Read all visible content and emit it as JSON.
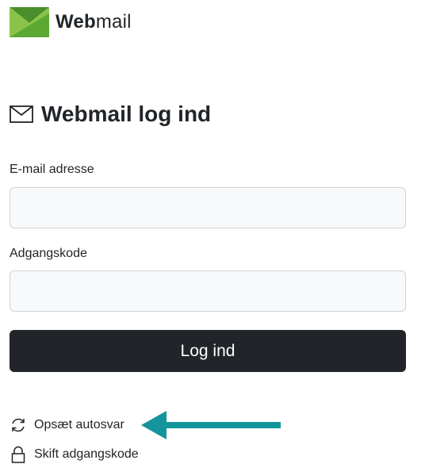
{
  "brand": {
    "name_bold": "Web",
    "name_regular": "mail",
    "colors": {
      "logo_light": "#8bc34a",
      "logo_dark": "#4a8f2a"
    }
  },
  "form": {
    "title": "Webmail log ind",
    "title_icon": "envelope-icon",
    "email_label": "E-mail adresse",
    "email_value": "",
    "password_label": "Adgangskode",
    "password_value": "",
    "submit_label": "Log ind"
  },
  "links": {
    "autoreply": {
      "label": "Opsæt autosvar",
      "icon": "refresh-icon"
    },
    "change_password": {
      "label": "Skift adgangskode",
      "icon": "lock-icon"
    }
  },
  "annotation": {
    "icon": "arrow-left-icon",
    "color": "#13959b"
  }
}
